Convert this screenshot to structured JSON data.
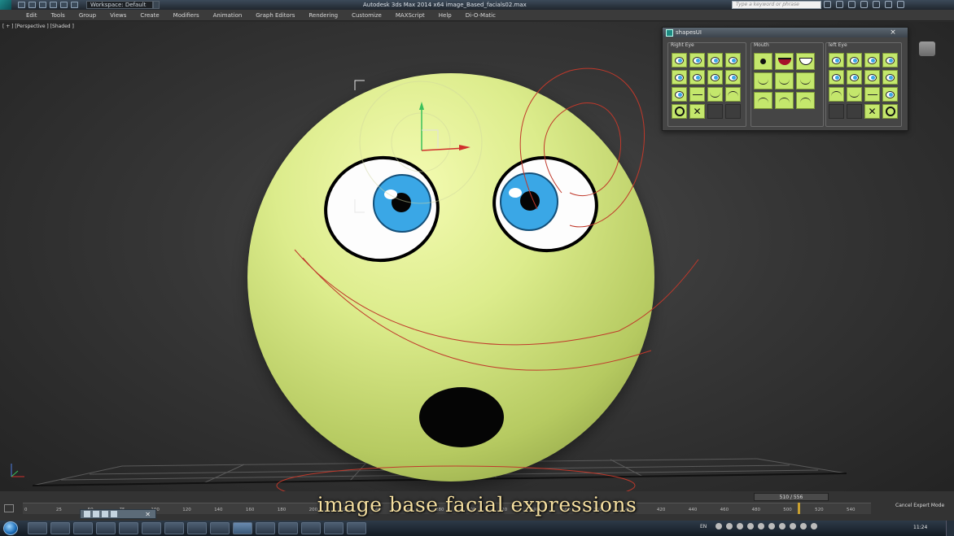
{
  "titlebar": {
    "workspace": "Workspace: Default",
    "window_title": "Autodesk 3ds Max  2014 x64     image_Based_facials02.max",
    "search_placeholder": "Type a keyword or phrase"
  },
  "menu": [
    "Edit",
    "Tools",
    "Group",
    "Views",
    "Create",
    "Modifiers",
    "Animation",
    "Graph Editors",
    "Rendering",
    "Customize",
    "MAXScript",
    "Help",
    "Di-O-Matic"
  ],
  "viewport": {
    "label": "[ + ] [Perspective ] [Shaded ]"
  },
  "panel": {
    "title": "shapesUI",
    "close": "×",
    "groups": {
      "right_eye": "Right Eye",
      "mouth": "Mouth",
      "left_eye": "left Eye"
    }
  },
  "timeline": {
    "frame_display": "510 / 556",
    "ticks": [
      "0",
      "25",
      "50",
      "75",
      "100",
      "120",
      "140",
      "160",
      "180",
      "200",
      "220",
      "240",
      "260",
      "280",
      "300",
      "320",
      "340",
      "360",
      "380",
      "400",
      "420",
      "440",
      "460",
      "480",
      "500",
      "520",
      "540"
    ],
    "current_frame": 510,
    "cancel_expert": "Cancel Expert Mode"
  },
  "caption": "image base facial expressions",
  "taskbar": {
    "language": "EN",
    "time": "11:24"
  },
  "colors": {
    "sphere": "#dcec8c",
    "iris": "#3aa7e6",
    "spline": "#c0392b",
    "button_green": "#c4e76c",
    "caption": "#f5dfa0"
  }
}
